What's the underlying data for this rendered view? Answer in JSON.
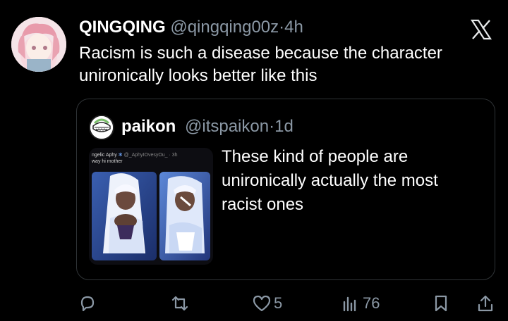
{
  "tweet": {
    "author_name": "QINGQING",
    "author_handle": "@qingqing00z",
    "separator": "·",
    "time": "4h",
    "text_lines": [
      "Racism is such a disease because the character",
      "unironically looks better like this"
    ]
  },
  "quote": {
    "author_name": "paikon",
    "author_handle": "@itspaikon",
    "separator": "·",
    "time": "1d",
    "image_header": {
      "name": "ngelic Aphy",
      "handle": "@_AphyIOvesyOu_",
      "time": "· 3h",
      "caption": "way hi mother"
    },
    "text_lines": [
      "These kind of people are",
      "unironically actually the most",
      "racist ones"
    ]
  },
  "actions": {
    "likes": "5",
    "views": "76"
  },
  "icons": {
    "brand": "x-logo-icon",
    "reply": "reply-icon",
    "retweet": "retweet-icon",
    "like": "heart-icon",
    "views": "views-icon",
    "bookmark": "bookmark-icon",
    "share": "share-icon"
  },
  "colors": {
    "background": "#000000",
    "text": "#e7e9ea",
    "muted": "#8b98a5",
    "border": "#2f3336"
  }
}
